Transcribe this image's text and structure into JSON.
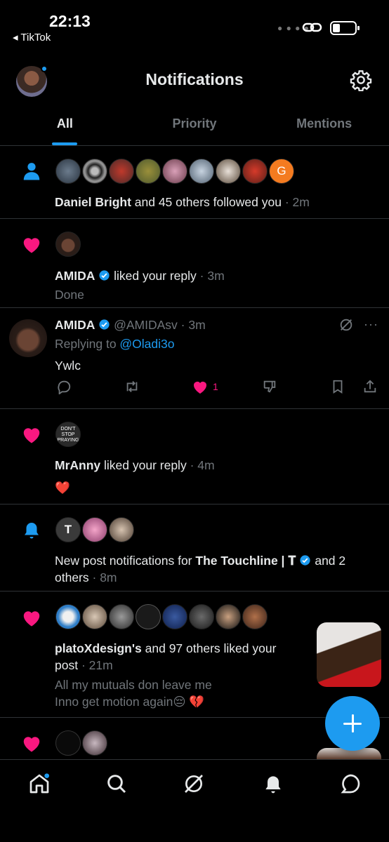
{
  "status_bar": {
    "time": "22:13",
    "back_app": "◂ TikTok"
  },
  "header": {
    "title": "Notifications"
  },
  "tabs": [
    {
      "label": "All",
      "active": true
    },
    {
      "label": "Priority",
      "active": false
    },
    {
      "label": "Mentions",
      "active": false
    }
  ],
  "notifications": {
    "follow": {
      "avatar_letter": "G",
      "name": "Daniel Bright",
      "text": " and 45 others followed you",
      "time": "· 2m"
    },
    "like1": {
      "name": "AMIDA",
      "text": " liked your reply",
      "time": "· 3m",
      "snippet": "Done"
    },
    "reply": {
      "name": "AMIDA",
      "handle": "@AMIDAsv · 3m",
      "replying_prefix": "Replying to ",
      "replying_to": "@Oladi3o",
      "body": "Ywlc",
      "like_count": "1"
    },
    "like2": {
      "avatar_text": "DON'T STOP PRAYING",
      "name": "MrAnny",
      "text": " liked your reply",
      "time": "· 4m",
      "snippet": "❤️"
    },
    "bell": {
      "prefix": "New post notifications for ",
      "name": "The Touchline | 𝐓",
      "suffix": " and 2",
      "line2": "others",
      "time": " · 8m"
    },
    "like3": {
      "name": "platoXdesign's",
      "text": " and 97 others liked your",
      "line2": "post",
      "time": " · 21m",
      "snippet1": "All my mutuals don leave me",
      "snippet2": "Inno get motion again😔 💔"
    }
  },
  "colors": {
    "accent": "#1d9bf0",
    "like": "#f91880",
    "background": "#000000",
    "muted": "#71767b"
  }
}
